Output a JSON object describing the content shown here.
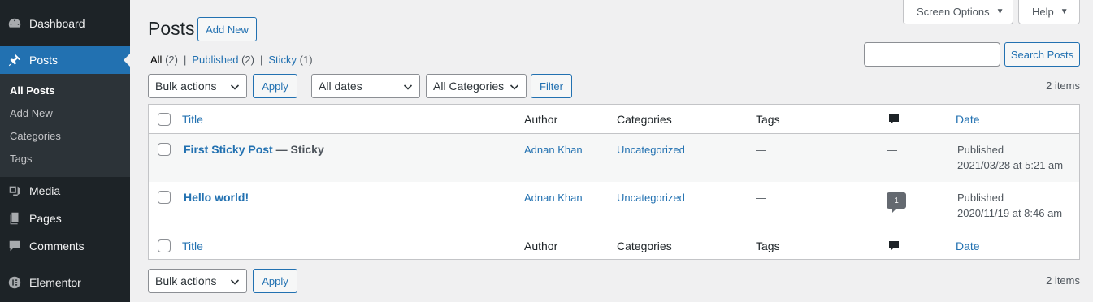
{
  "sidebar": {
    "dashboard": "Dashboard",
    "posts": "Posts",
    "submenu": [
      "All Posts",
      "Add New",
      "Categories",
      "Tags"
    ],
    "media": "Media",
    "pages": "Pages",
    "comments": "Comments",
    "elementor": "Elementor"
  },
  "header": {
    "screen_options": "Screen Options",
    "help": "Help",
    "title": "Posts",
    "add_new": "Add New"
  },
  "views": {
    "all": "All",
    "all_count": "(2)",
    "published": "Published",
    "published_count": "(2)",
    "sticky": "Sticky",
    "sticky_count": "(1)"
  },
  "search": {
    "value": "",
    "button": "Search Posts"
  },
  "filters": {
    "bulk_actions": "Bulk actions",
    "apply": "Apply",
    "dates": "All dates",
    "categories": "All Categories",
    "filter": "Filter",
    "items_count": "2 items"
  },
  "table": {
    "columns": {
      "title": "Title",
      "author": "Author",
      "categories": "Categories",
      "tags": "Tags",
      "date": "Date"
    },
    "rows": [
      {
        "title": "First Sticky Post",
        "state": " — Sticky",
        "author": "Adnan Khan",
        "category": "Uncategorized",
        "tags": "—",
        "comments": "—",
        "status": "Published",
        "date": "2021/03/28 at 5:21 am"
      },
      {
        "title": "Hello world!",
        "state": "",
        "author": "Adnan Khan",
        "category": "Uncategorized",
        "tags": "—",
        "comments": "1",
        "status": "Published",
        "date": "2020/11/19 at 8:46 am"
      }
    ]
  },
  "bottom": {
    "bulk_actions": "Bulk actions",
    "apply": "Apply",
    "items_count": "2 items"
  },
  "colors": {
    "sidebar_bg": "#1d2327",
    "accent": "#2271b1",
    "page_bg": "#f0f0f1"
  }
}
